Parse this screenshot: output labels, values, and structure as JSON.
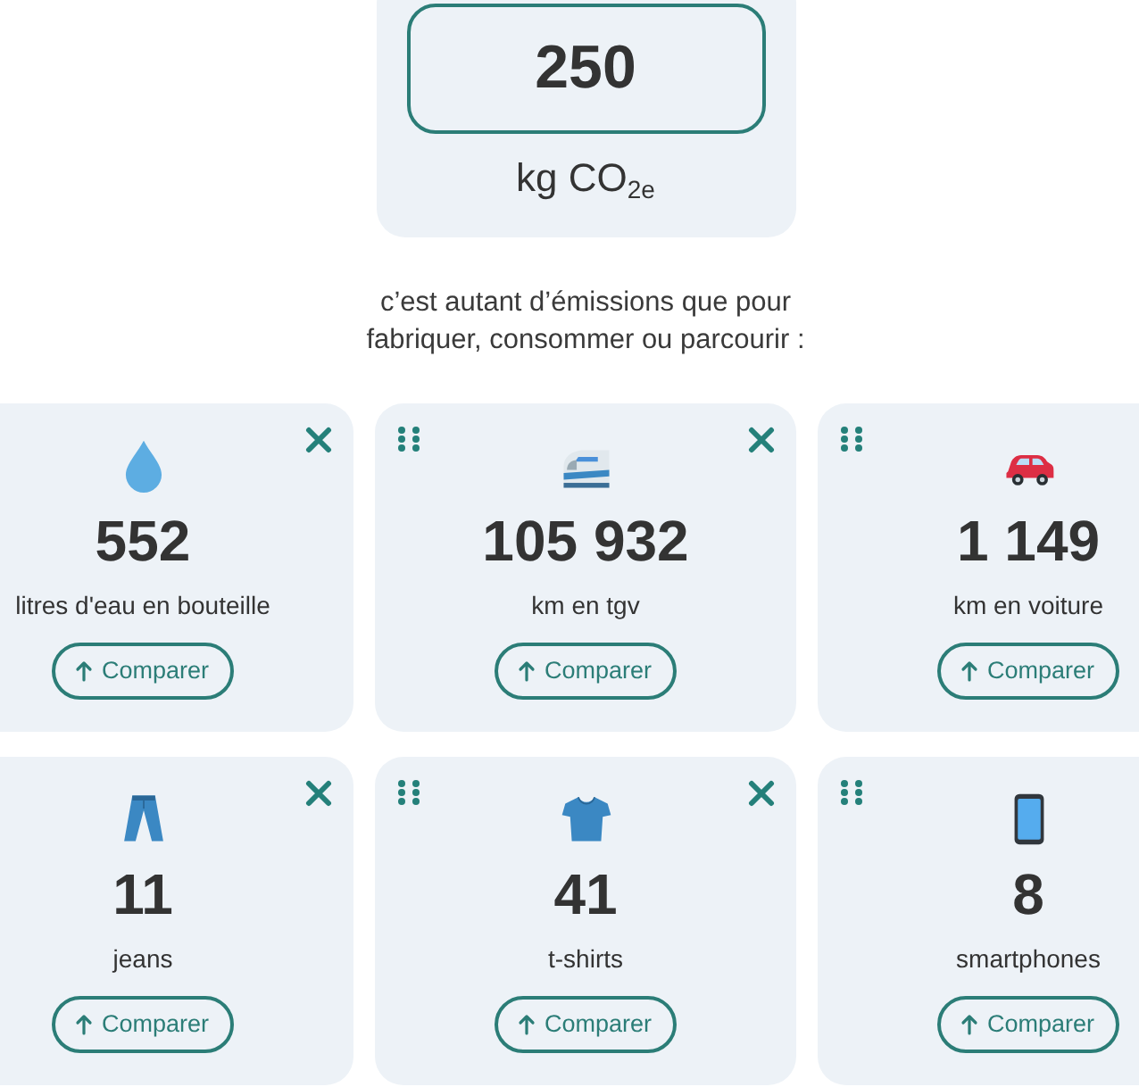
{
  "emissions": {
    "value": "250",
    "unit": "kg CO$_{2e}$"
  },
  "intro": "c’est autant d’émissions que pour fabriquer, consommer ou parcourir :",
  "comparisons": [
    {
      "value": "552",
      "label": "litres d'eau en bouteille",
      "button": "Comparer"
    },
    {
      "value": "105 932",
      "label": "km en tgv",
      "button": "Comparer"
    },
    {
      "value": "1 149",
      "label": "km en voiture",
      "button": "Comparer"
    },
    {
      "value": "11",
      "label": "jeans",
      "button": "Comparer"
    },
    {
      "value": "41",
      "label": "t-shirts",
      "button": "Comparer"
    },
    {
      "value": "8",
      "label": "smartphones",
      "button": "Comparer"
    }
  ]
}
